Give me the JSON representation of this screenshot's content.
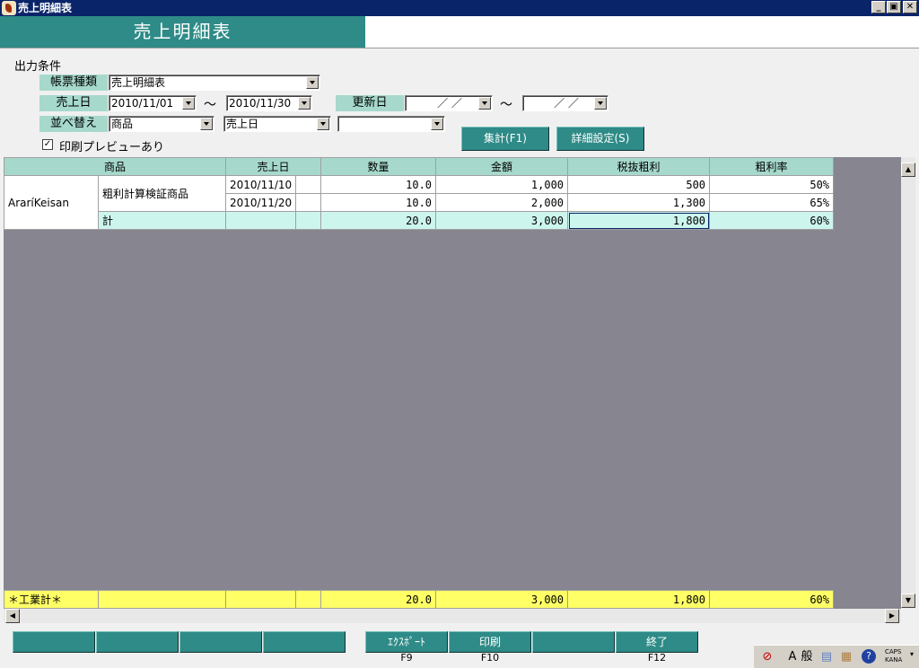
{
  "window": {
    "title": "売上明細表",
    "min": "_",
    "max": "▣",
    "close": "✕"
  },
  "header": {
    "title": "売上明細表"
  },
  "conditions": {
    "section_label": "出力条件",
    "report_type_label": "帳票種類",
    "report_type_value": "売上明細表",
    "sales_date_label": "売上日",
    "sales_date_from": "2010/11/01",
    "sales_date_to": "2010/11/30",
    "range_sep": "～",
    "update_date_label": "更新日",
    "update_date_from": "／  ／",
    "update_date_to": "／  ／",
    "sort_label": "並べ替え",
    "sort1": "商品",
    "sort2": "売上日",
    "sort3": "",
    "preview_label": "印刷プレビューあり",
    "preview_checked": "✓",
    "total_button": "集計(F1)",
    "detail_button": "詳細設定(S)"
  },
  "grid": {
    "headers": [
      "商品",
      "売上日",
      "数量",
      "金額",
      "税抜粗利",
      "粗利率"
    ],
    "customer": "AraríKeisan",
    "product": "粗利計算検証商品",
    "rows": [
      {
        "date": "2010/11/10",
        "qty": "10.0",
        "amount": "1,000",
        "profit": "500",
        "rate": "50%"
      },
      {
        "date": "2010/11/20",
        "qty": "10.0",
        "amount": "2,000",
        "profit": "1,300",
        "rate": "65%"
      }
    ],
    "subtotal": {
      "label": "計",
      "qty": "20.0",
      "amount": "3,000",
      "profit": "1,800",
      "rate": "60%"
    },
    "grand_total": {
      "label": "＊工業計＊",
      "qty": "20.0",
      "amount": "3,000",
      "profit": "1,800",
      "rate": "60%"
    }
  },
  "fkeys": {
    "f9_label": "ｴｸｽﾎﾟｰﾄ",
    "f9_num": "F9",
    "f10_label": "印刷",
    "f10_num": "F10",
    "f12_label": "終了",
    "f12_num": "F12"
  },
  "tray": {
    "ime_mode": "A",
    "ime_kanji": "般",
    "caps": "CAPS",
    "kana": "KANA"
  }
}
